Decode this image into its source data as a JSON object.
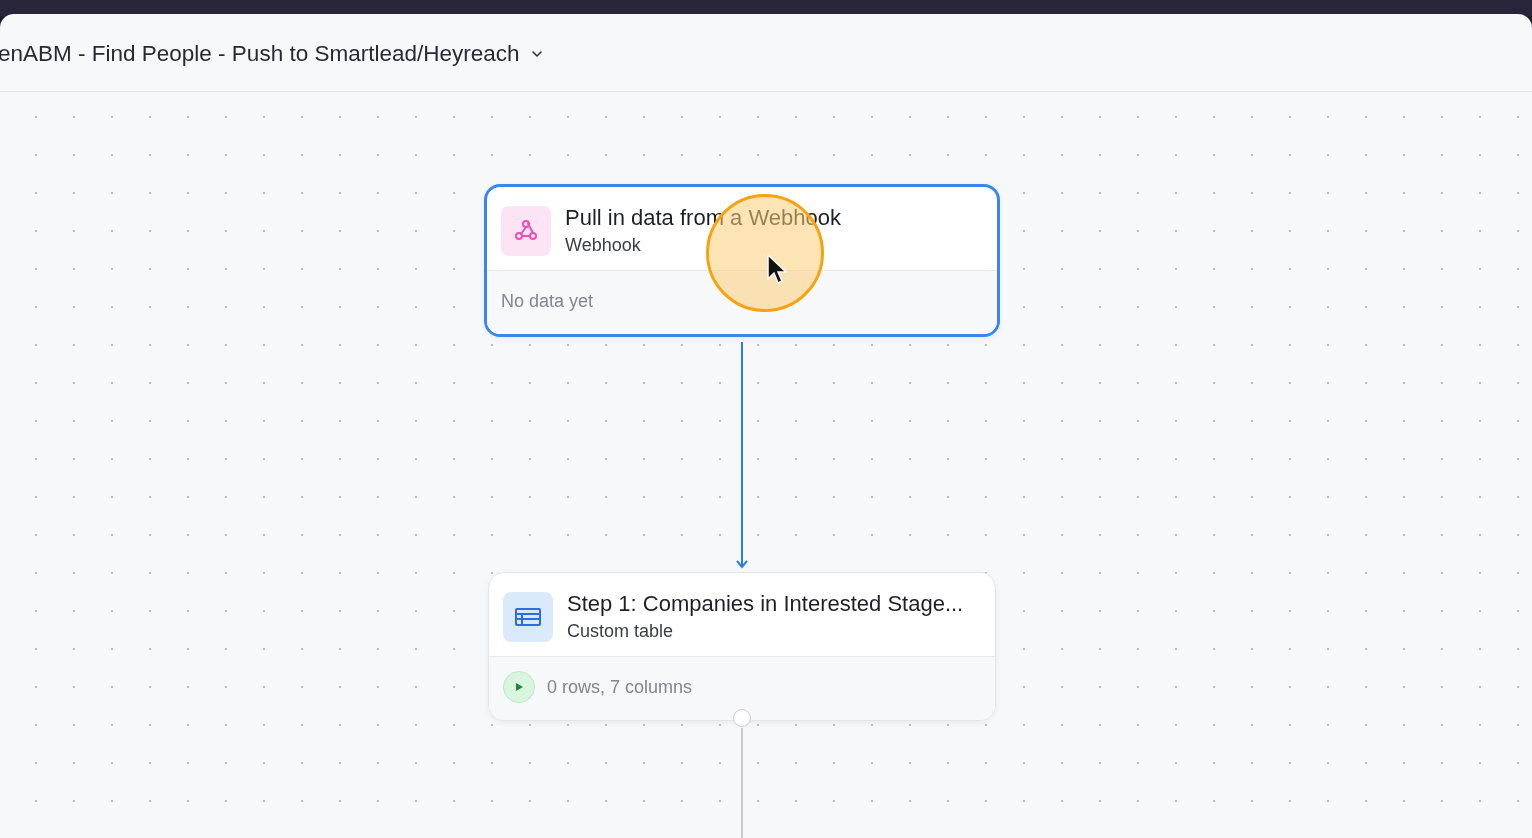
{
  "header": {
    "title": "enABM - Find People - Push to Smartlead/Heyreach"
  },
  "nodes": [
    {
      "kind": "webhook",
      "selected": true,
      "title": "Pull in data from a Webhook",
      "subtitle": "Webhook",
      "footer": "No data yet",
      "runnable": false
    },
    {
      "kind": "table",
      "selected": false,
      "title": "Step 1: Companies in Interested Stage...",
      "subtitle": "Custom table",
      "footer": "0 rows, 7 columns",
      "runnable": true
    }
  ]
}
